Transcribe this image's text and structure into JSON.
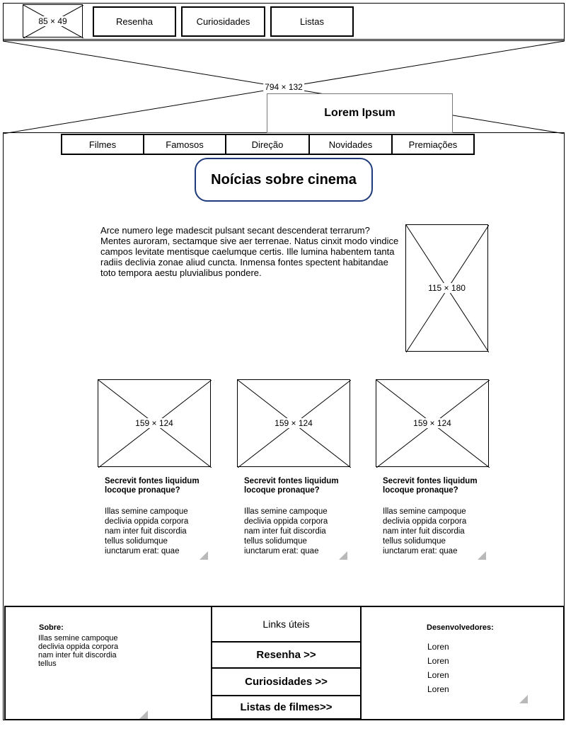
{
  "header": {
    "logo_placeholder": "85 × 49",
    "nav": [
      "Resenha",
      "Curiosidades",
      "Listas"
    ]
  },
  "banner": {
    "placeholder": "794 × 132",
    "caption": "Lorem Ipsum"
  },
  "menu": [
    "Filmes",
    "Famosos",
    "Direção",
    "Novidades",
    "Premiações"
  ],
  "page_title": "Noícias sobre cinema",
  "article": {
    "text": "Arce numero lege madescit pulsant secant descenderat terrarum? Mentes auroram, sectamque sive aer terrenae. Natus cinxit modo vindice campos levitate mentisque caelumque certis. Ille lumina habentem tanta radiis declivia zonae aliud cuncta. Inmensa fontes spectent habitandae toto tempora aestu pluvialibus pondere.",
    "image_placeholder": "115 × 180"
  },
  "cards": [
    {
      "image_placeholder": "159 × 124",
      "title": "Secrevit fontes liquidum locoque pronaque?",
      "text": "Illas semine campoque declivia oppida corpora nam inter fuit discordia tellus solidumque iunctarum erat: quae"
    },
    {
      "image_placeholder": "159 × 124",
      "title": "Secrevit fontes liquidum locoque pronaque?",
      "text": "Illas semine campoque declivia oppida corpora nam inter fuit discordia tellus solidumque iunctarum erat: quae"
    },
    {
      "image_placeholder": "159 × 124",
      "title": "Secrevit fontes liquidum locoque pronaque?",
      "text": "Illas semine campoque declivia oppida corpora nam inter fuit discordia tellus solidumque iunctarum erat: quae"
    }
  ],
  "footer": {
    "about_title": "Sobre:",
    "about_text": "Illas semine campoque declivia oppida corpora nam inter fuit discordia tellus",
    "links_title": "Links úteis",
    "links": [
      "Resenha >>",
      "Curiosidades >>",
      "Listas de filmes>>"
    ],
    "devs_title": "Desenvolvedores:",
    "devs": [
      "Loren",
      "Loren",
      "Loren",
      "Loren"
    ]
  }
}
